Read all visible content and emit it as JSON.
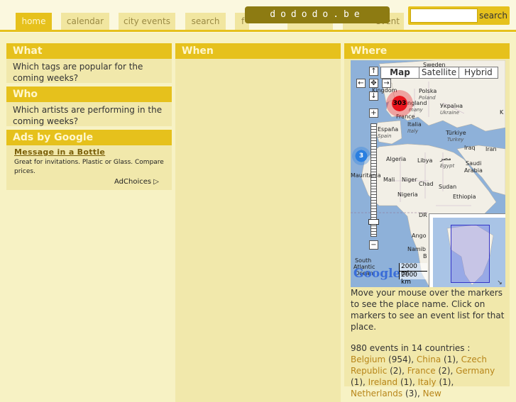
{
  "nav": {
    "tabs": [
      {
        "label": "home"
      },
      {
        "label": "calendar"
      },
      {
        "label": "city events"
      },
      {
        "label": "search"
      },
      {
        "label": "f"
      },
      {
        "label": "event"
      }
    ],
    "logo": "dododo.be",
    "search": {
      "placeholder": "",
      "button": "search"
    }
  },
  "what": {
    "title": "What",
    "text": "Which tags are popular for the coming weeks?"
  },
  "who": {
    "title": "Who",
    "text": "Which artists are performing in the coming weeks?"
  },
  "ads": {
    "title": "Ads by Google",
    "link": "Message in a Bottle",
    "text": "Great for invitations. Plastic or Glass. Compare prices.",
    "adchoices": "AdChoices"
  },
  "when": {
    "title": "When"
  },
  "where": {
    "title": "Where",
    "map": {
      "types": [
        "Map",
        "Satellite",
        "Hybrid"
      ],
      "selected_type": "Map",
      "clusters": [
        {
          "label": "303"
        },
        {
          "label": "3"
        }
      ],
      "labels": {
        "sweden": "Sweden",
        "polska": "Polska",
        "poland": "Poland",
        "kingdom": "Kingdom",
        "ngland": "ngland",
        "many": "many",
        "france": "France",
        "ukraina": "Україна",
        "ukraine": "Ukraine",
        "italia": "Italia",
        "italy": "Italy",
        "espana": "España",
        "spain": "Spain",
        "turkiye": "Türkiye",
        "turkey": "Turkey",
        "iraq": "Iraq",
        "iran": "Iran",
        "algeria": "Algeria",
        "libya": "Libya",
        "misr": "مصر",
        "egypt": "Egypt",
        "saudi": "Saudi",
        "arabia": "Arabia",
        "mauritania": "Mauritania",
        "mali": "Mali",
        "niger": "Niger",
        "chad": "Chad",
        "sudan": "Sudan",
        "nigeria": "Nigeria",
        "ethiopia": "Ethiopia",
        "k": "K",
        "dr": "DR",
        "ango": "Ango",
        "namib": "Namib",
        "b": "B",
        "south": "South",
        "atlantic": "Atlantic",
        "ocean": "Ocean"
      },
      "google": "Google",
      "scale": [
        "2000 mi",
        "2000 km"
      ]
    },
    "hint": "Move your mouse over the markers to see the place name. Click on markers to see an event list for that place.",
    "summary_prefix": "980 events in 14 countries : ",
    "countries": [
      {
        "name": "Belgium",
        "count": " (954), "
      },
      {
        "name": "China",
        "count": " (1), "
      },
      {
        "name": "Czech Republic",
        "count": " (2), "
      },
      {
        "name": "France",
        "count": " (2), "
      },
      {
        "name": "Germany",
        "count": " (1), "
      },
      {
        "name": "Ireland",
        "count": " (1), "
      },
      {
        "name": "Italy",
        "count": " (1), "
      },
      {
        "name": "Netherlands",
        "count": " (3), "
      },
      {
        "name": "New",
        "count": ""
      }
    ]
  },
  "colors": {
    "accent": "#e6c11c",
    "background": "#f7f2c4",
    "panel": "#f1e8ab",
    "logo_bg": "#8d7b12",
    "link": "#b8861a"
  }
}
